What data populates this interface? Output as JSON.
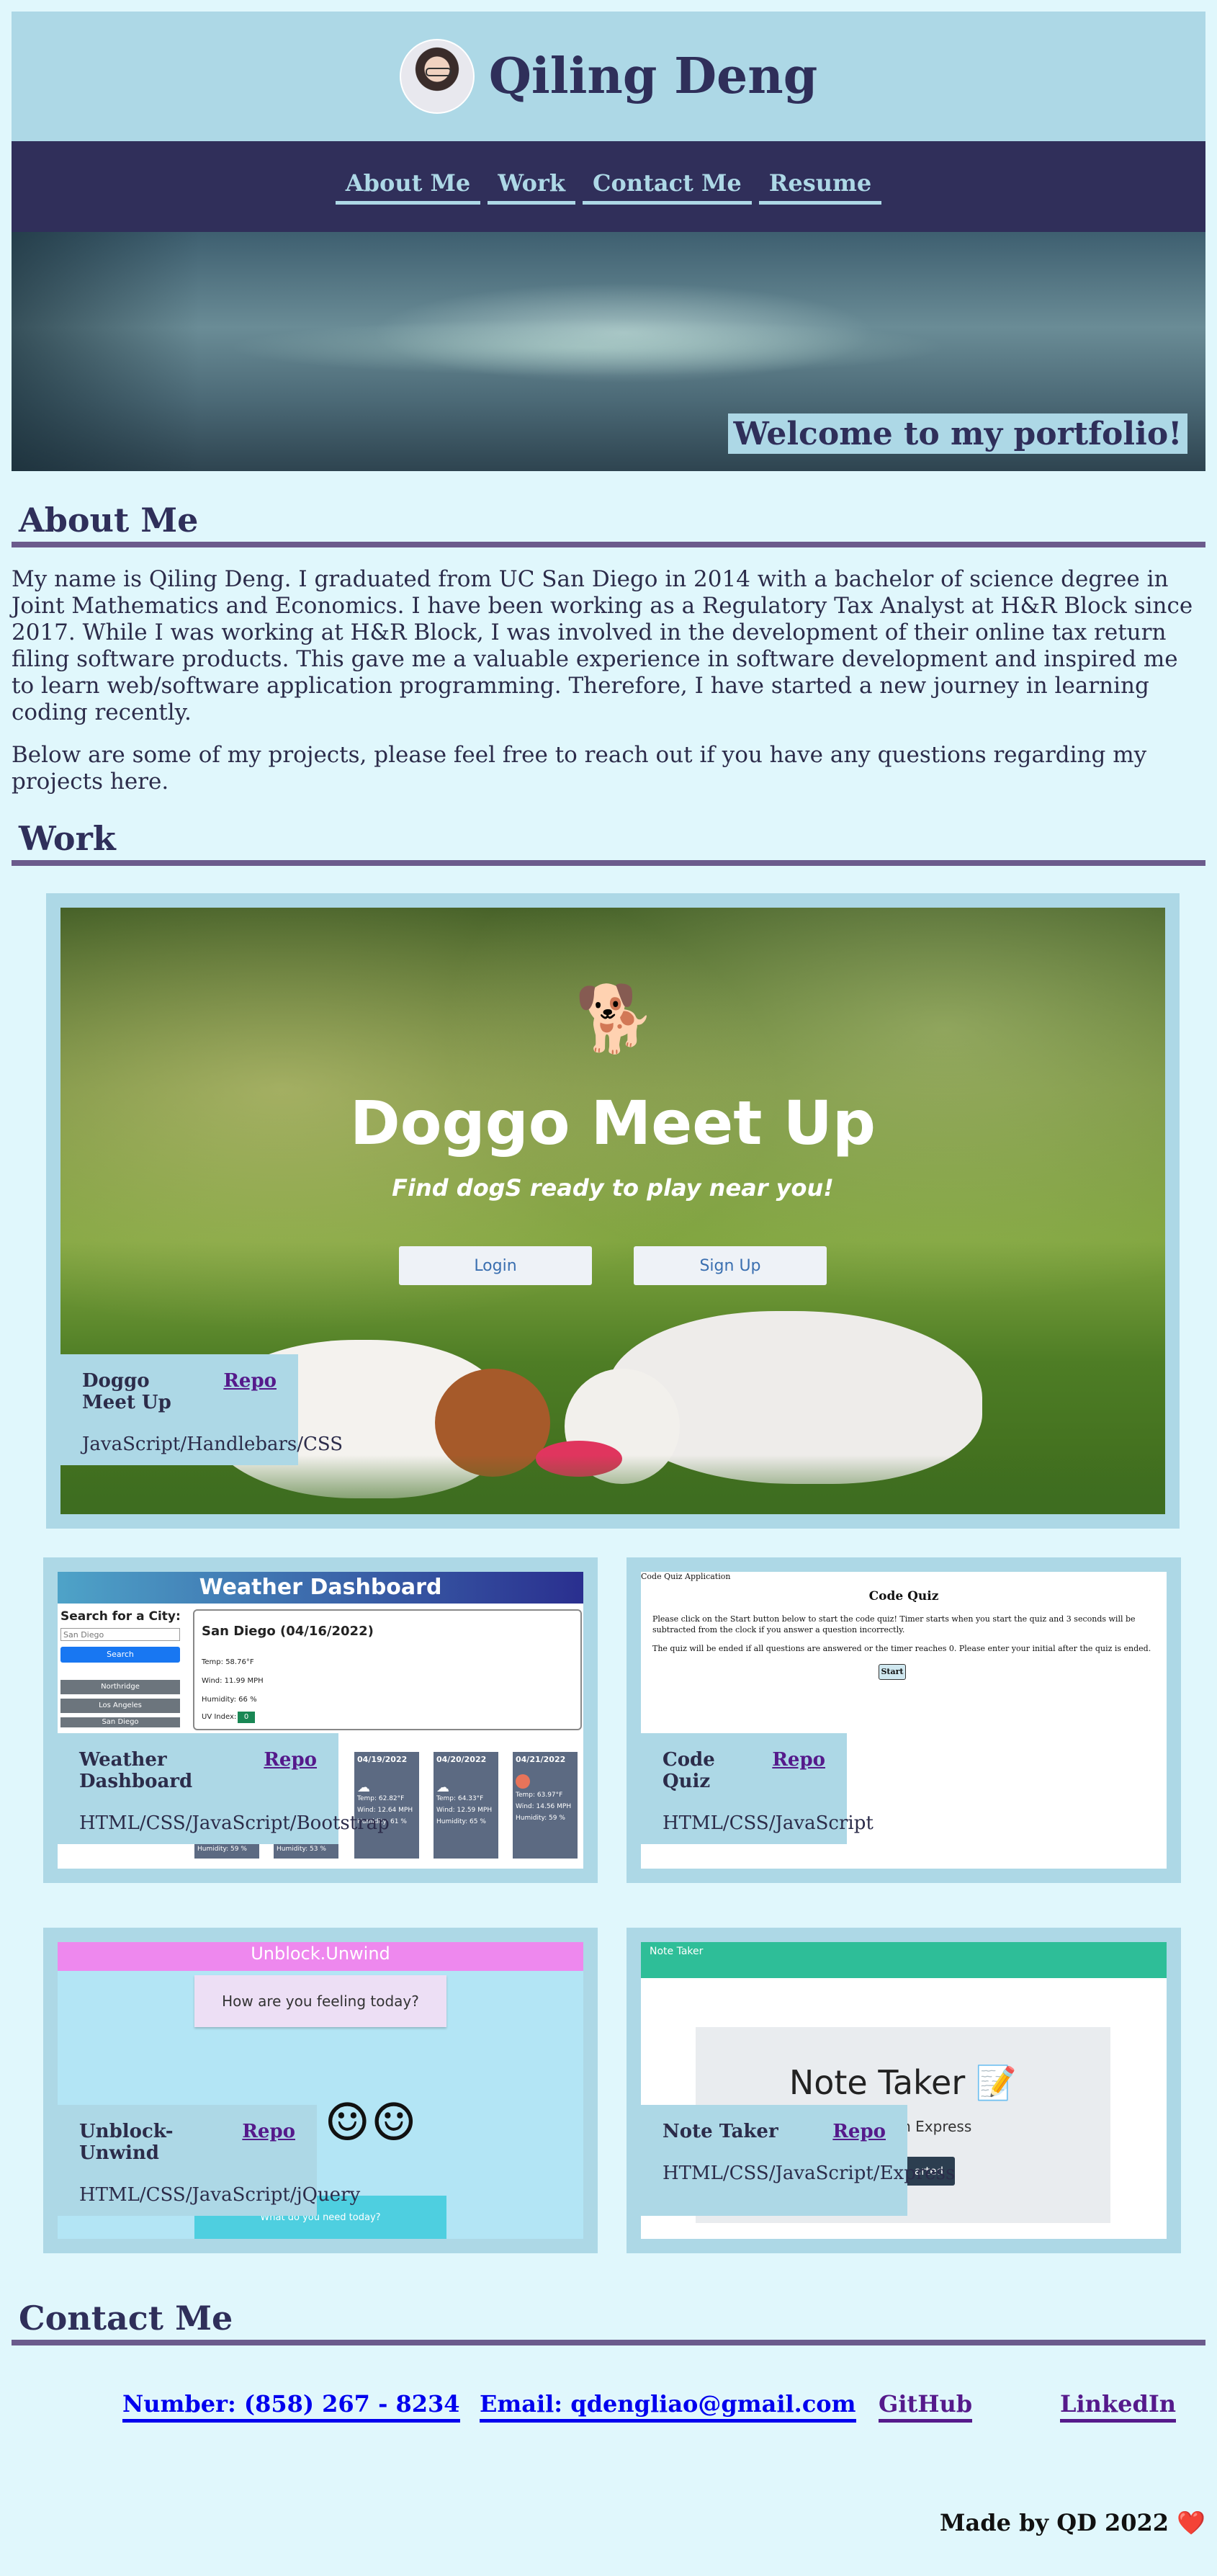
{
  "header": {
    "name": "Qiling Deng"
  },
  "nav": {
    "items": [
      "About Me",
      "Work",
      "Contact Me",
      "Resume"
    ]
  },
  "hero": {
    "welcome": "Welcome to my portfolio!"
  },
  "about": {
    "title": "About Me",
    "paragraph1": "My name is Qiling Deng. I graduated from UC San Diego in 2014 with a bachelor of science degree in Joint Mathematics and Economics. I have been working as a Regulatory Tax Analyst at H&R Block since 2017. While I was working at H&R Block, I was involved in the development of their online tax return filing software products. This gave me a valuable experience in software development and inspired me to learn web/software application programming. Therefore, I have started a new journey in learning coding recently.",
    "paragraph2": "Below are some of my projects, please feel free to reach out if you have any questions regarding my projects here."
  },
  "work": {
    "title": "Work",
    "projects": [
      {
        "name": "Doggo Meet Up",
        "repo": "Repo",
        "tech": "JavaScript/Handlebars/CSS"
      },
      {
        "name": "Weather Dashboard",
        "repo": "Repo",
        "tech": "HTML/CSS/JavaScript/Bootstrap"
      },
      {
        "name": "Code Quiz",
        "repo": "Repo",
        "tech": "HTML/CSS/JavaScript"
      },
      {
        "name": "Unblock-Unwind",
        "repo": "Repo",
        "tech": "HTML/CSS/JavaScript/jQuery"
      },
      {
        "name": "Note Taker",
        "repo": "Repo",
        "tech": "HTML/CSS/JavaScript/Express"
      }
    ],
    "doggo_preview": {
      "title": "Doggo Meet Up",
      "tagline": "Find dogS ready to play near you!",
      "login": "Login",
      "signup": "Sign Up"
    },
    "weather_preview": {
      "title": "Weather Dashboard",
      "search_label": "Search for a City:",
      "search_placeholder": "San Diego",
      "search_button": "Search",
      "cities": [
        "Northridge",
        "Los Angeles",
        "San Diego"
      ],
      "current_city": "San Diego (04/16/2022)",
      "temp": "Temp: 58.76°F",
      "wind": "Wind: 11.99 MPH",
      "humidity": "Humidity: 66 %",
      "uv": "UV Index:",
      "uv_value": "0",
      "forecast": [
        {
          "date": "04/19/2022",
          "temp": "Temp: 62.82°F",
          "wind": "Wind: 12.64 MPH",
          "humidity": "Humidity: 61 %"
        },
        {
          "date": "04/20/2022",
          "temp": "Temp: 64.33°F",
          "wind": "Wind: 12.59 MPH",
          "humidity": "Humidity: 65 %"
        },
        {
          "date": "04/21/2022",
          "temp": "Temp: 63.97°F",
          "wind": "Wind: 14.56 MPH",
          "humidity": "Humidity: 59 %"
        }
      ],
      "hidden_humidity": [
        "Humidity: 59 %",
        "Humidity: 53 %"
      ]
    },
    "quiz_preview": {
      "tab": "Code Quiz Application",
      "title": "Code Quiz",
      "line1": "Please click on the Start button below to start the code quiz! Timer starts when you start the quiz and 3 seconds will be subtracted from the clock if you answer a question incorrectly.",
      "line2": "The quiz will be ended if all questions are answered or the timer reaches 0. Please enter your initial after the quiz is ended.",
      "start": "Start"
    },
    "unblock_preview": {
      "title": "Unblock.Unwind",
      "question": "How are you feeling today?",
      "faces": "☺☺",
      "bottom": "What do you need today?"
    },
    "note_preview": {
      "bar": "Note Taker",
      "title": "Note Taker 📝",
      "sub": "ith Express",
      "btn": "arted"
    }
  },
  "contact": {
    "title": "Contact Me",
    "phone": "Number: (858) 267 - 8234",
    "email": "Email: qdengliao@gmail.com",
    "github": "GitHub",
    "linkedin": "LinkedIn"
  },
  "footer": {
    "text": "Made by QD 2022 ❤️"
  },
  "colors": {
    "page_bg": "#e0f7fc",
    "light_blue": "#add8e6",
    "navy": "#302f5a",
    "purple_rule": "#6b5b8c",
    "link_blue": "#0000ee",
    "visited": "#551a8b"
  }
}
